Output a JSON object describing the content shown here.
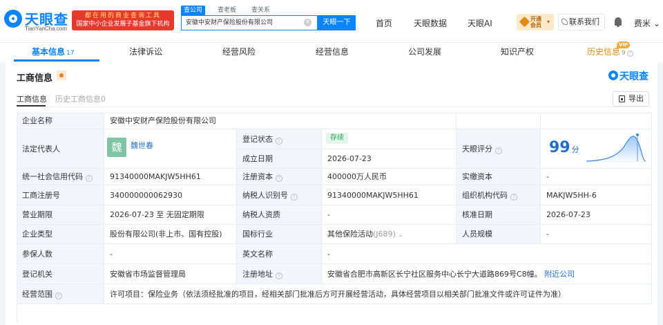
{
  "brand": {
    "name": "天眼查",
    "domain": "TianYanCha.com",
    "promo_line1": "都在用的商业查询工具",
    "promo_line2": "国家中小企业发展子基金旗下机构"
  },
  "search": {
    "tabs": [
      "查公司",
      "查老板",
      "查关系"
    ],
    "query": "安徽中安财产保险股份有限公司",
    "clear_glyph": "×",
    "button": "天眼一下"
  },
  "nav": {
    "items": [
      "首页",
      "天眼数据",
      "天眼AI"
    ],
    "vip_label": "开通会员",
    "vip_caret": "▾",
    "contact": "联系我们",
    "user": "费米",
    "user_caret": "⌄"
  },
  "sections": {
    "tabs": [
      {
        "label": "基本信息",
        "count": "17"
      },
      {
        "label": "法律诉讼",
        "count": ""
      },
      {
        "label": "经营风险",
        "count": ""
      },
      {
        "label": "经营信息",
        "count": ""
      },
      {
        "label": "公司发展",
        "count": ""
      },
      {
        "label": "知识产权",
        "count": ""
      },
      {
        "label": "历史信息",
        "count": "9"
      }
    ],
    "vip_tag": "VIP",
    "help_glyph": "?"
  },
  "card": {
    "title": "工商信息",
    "brand_text": "天眼查",
    "sub_tabs": [
      "工商信息",
      "历史工商信息0"
    ],
    "export": "导出"
  },
  "business": {
    "name_label": "企业名称",
    "name_value": "安徽中安财产保险股份有限公司",
    "rep_label": "法定代表人",
    "rep_avatar": "魏",
    "rep_name": "魏世春",
    "status_label": "登记状态",
    "status_value": "存续",
    "founded_label": "成立日期",
    "founded_value": "2026-07-23",
    "score_label": "天眼评分",
    "score_value": "99",
    "score_unit": "分",
    "credit_label": "统一社会信用代码",
    "credit_value": "91340000MAKJW5HH61",
    "reg_capital_label": "注册资本",
    "reg_capital_value": "400000万人民币",
    "paid_capital_label": "实缴资本",
    "paid_capital_value": "-",
    "reg_no_label": "工商注册号",
    "reg_no_value": "340000000062930",
    "tax_id_label": "纳税人识别号",
    "tax_id_value": "91340000MAKJW5HH61",
    "org_code_label": "组织机构代码",
    "org_code_value": "MAKJW5HH-6",
    "term_label": "营业期限",
    "term_value": "2026-07-23 至 无固定期限",
    "tax_qual_label": "纳税人资质",
    "tax_qual_value": "-",
    "approve_label": "核准日期",
    "approve_value": "2026-07-23",
    "type_label": "企业类型",
    "type_value": "股份有限公司(非上市、国有控股)",
    "industry_label": "国标行业",
    "industry_value": "其他保险活动",
    "industry_code": "(J689)",
    "industry_caret": "⌄",
    "staff_label": "人员规模",
    "staff_value": "-",
    "insured_label": "参保人数",
    "insured_value": "-",
    "en_name_label": "英文名称",
    "en_name_value": "-",
    "authority_label": "登记机关",
    "authority_value": "安徽省市场监督管理局",
    "address_label": "注册地址",
    "address_value": "安徽省合肥市高新区长宁社区服务中心长宁大道路869号C8幢。",
    "address_link": "附近公司",
    "scope_label": "经营范围",
    "scope_value": "许可项目：保险业务（依法须经批准的项目，经相关部门批准后方可开展经营活动，具体经营项目以相关部门批准文件或许可证件为准）",
    "help_glyph": "?"
  },
  "colors": {
    "accent": "#0a84ff",
    "link": "#2170c8",
    "label_bg": "#f2f6fc",
    "promo_red": "#e8372d",
    "status_green": "#2aa05a",
    "avatar_green": "#7fc5a3"
  }
}
